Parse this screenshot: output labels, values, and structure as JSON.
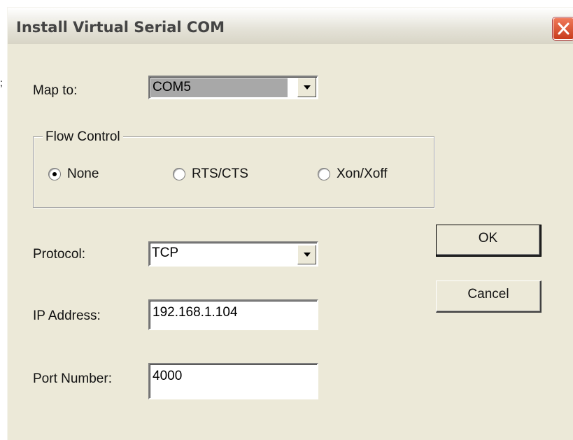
{
  "window": {
    "title": "Install Virtual Serial COM"
  },
  "map_to": {
    "label": "Map to:",
    "value": "COM5"
  },
  "flow_control": {
    "legend": "Flow Control",
    "options": [
      {
        "label": "None",
        "checked": true
      },
      {
        "label": "RTS/CTS",
        "checked": false
      },
      {
        "label": "Xon/Xoff",
        "checked": false
      }
    ]
  },
  "protocol": {
    "label": "Protocol:",
    "value": "TCP"
  },
  "ip_address": {
    "label": "IP Address:",
    "value": "192.168.1.104"
  },
  "port_number": {
    "label": "Port Number:",
    "value": "4000"
  },
  "buttons": {
    "ok": "OK",
    "cancel": "Cancel"
  },
  "icons": {
    "close": "close-icon",
    "dropdown": "chevron-down-icon"
  },
  "colors": {
    "close_button": "#d9532f",
    "dialog_background": "#ece9d8"
  }
}
